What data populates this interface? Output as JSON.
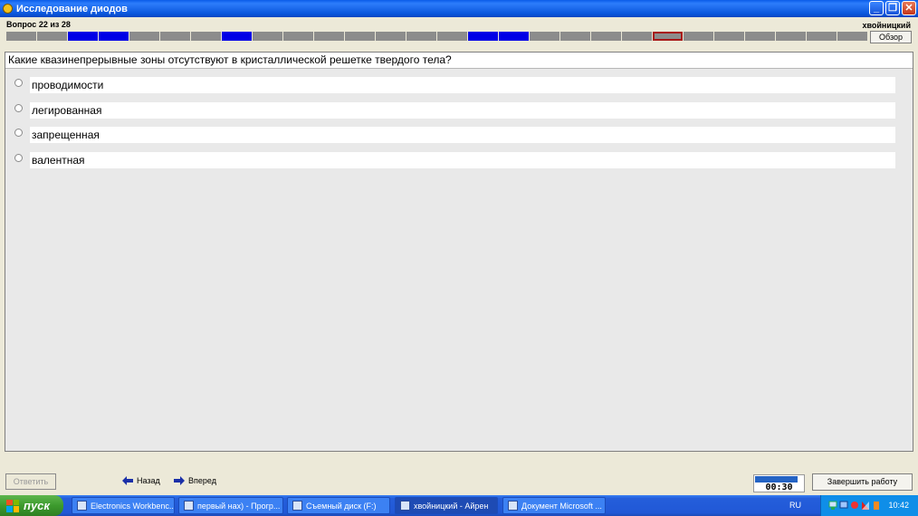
{
  "window": {
    "title": "Исследование диодов",
    "controls": [
      "minimize",
      "restore",
      "close"
    ]
  },
  "header": {
    "question_counter": "Вопрос 22 из 28",
    "user": "хвойницкий",
    "overview_button": "Обзор",
    "progress_states": [
      "u",
      "u",
      "a",
      "a",
      "u",
      "u",
      "u",
      "a",
      "u",
      "u",
      "u",
      "u",
      "u",
      "u",
      "u",
      "a",
      "a",
      "u",
      "u",
      "u",
      "u",
      "c",
      "u",
      "u",
      "u",
      "u",
      "u",
      "u"
    ]
  },
  "question": {
    "text": "Какие квазинепрерывные зоны отсутствуют в кристаллической решетке твердого тела?",
    "options": [
      "проводимости",
      "легированная",
      "запрещенная",
      "валентная"
    ]
  },
  "controls": {
    "answer": "Ответить",
    "back": "Назад",
    "forward": "Вперед",
    "timer": "00:30",
    "timer_progress_fraction": 0.85,
    "finish": "Завершить работу"
  },
  "taskbar": {
    "start": "пуск",
    "tasks": [
      "Electronics Workbenc...",
      "первый нах) - Прогр...",
      "Съемный диск (F:)",
      "хвойницкий - Айрен",
      "Документ Microsoft ..."
    ],
    "language": "RU",
    "clock": "10:42"
  },
  "colors": {
    "answered": "#0000e6",
    "unanswered": "#8c8c8c",
    "current_border": "#a81818",
    "title_bar": "#0a5ce8"
  }
}
